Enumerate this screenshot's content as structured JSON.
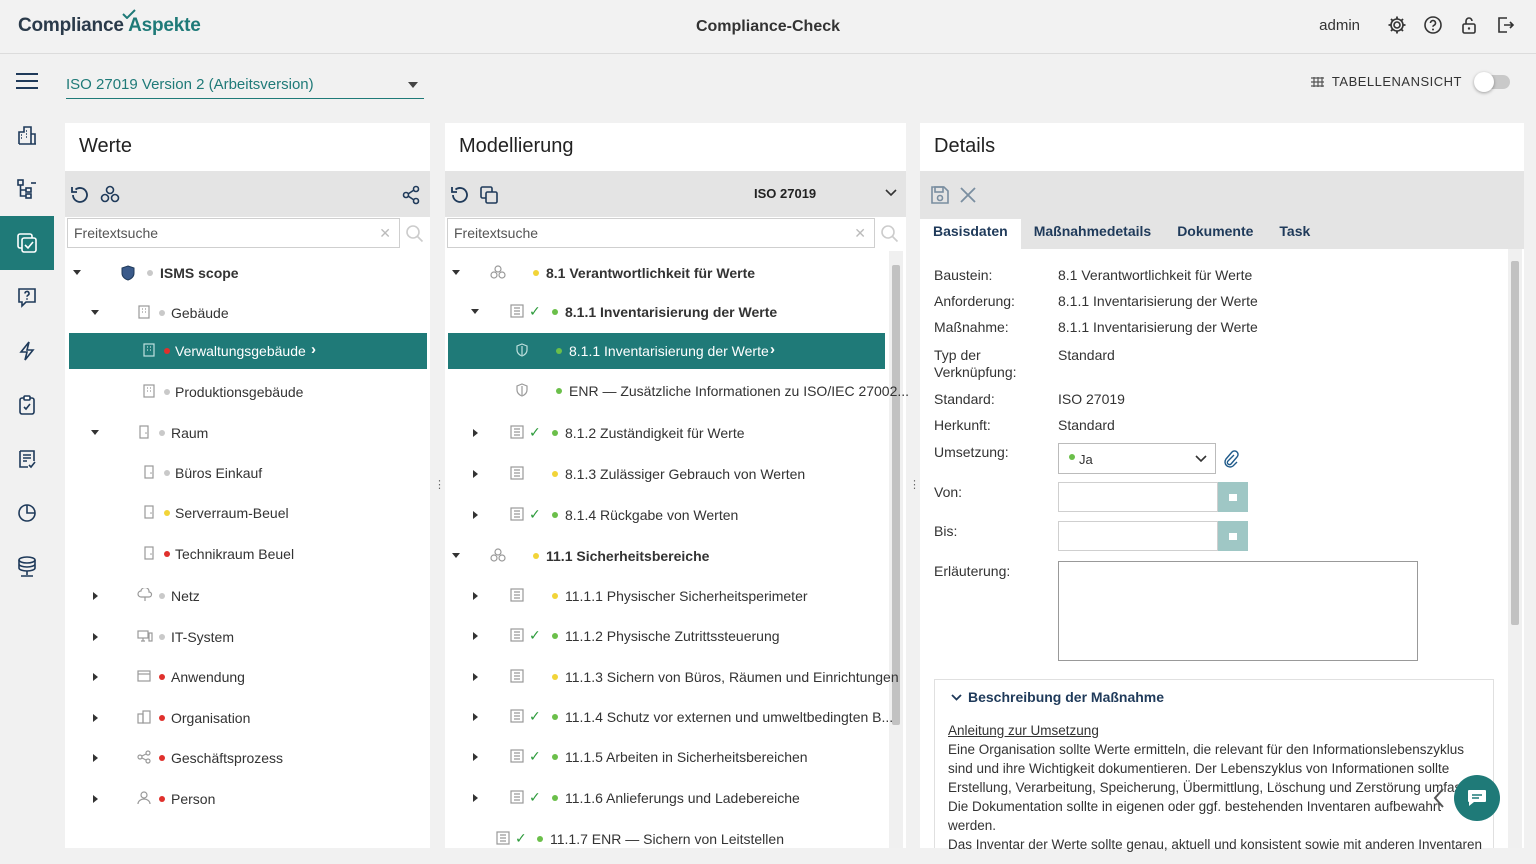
{
  "header": {
    "logo_part1": "Compliance",
    "logo_part2": "Aspekte",
    "title": "Compliance-Check",
    "user": "admin",
    "icons": [
      "gear-icon",
      "help-icon",
      "lock-icon",
      "logout-icon"
    ]
  },
  "nav": {
    "items": [
      "menu-icon",
      "buildings-icon",
      "tree-icon",
      "compliance-icon",
      "question-icon",
      "lightning-icon",
      "clipboard-check-icon",
      "report-icon",
      "pie-chart-icon",
      "database-icon"
    ],
    "active_color": "#1f7a78"
  },
  "toolbar": {
    "standard_select": "ISO 27019 Version 2 (Arbeitsversion)",
    "table_view_label": "TABELLENANSICHT"
  },
  "werte": {
    "title": "Werte",
    "search_placeholder": "Freitextsuche",
    "items": [
      {
        "label": "ISMS scope",
        "dot": "grey",
        "bold": true
      },
      {
        "label": "Gebäude",
        "dot": "grey"
      },
      {
        "label": "Verwaltungsgebäude",
        "dot": "red",
        "selected": true
      },
      {
        "label": "Produktionsgebäude",
        "dot": "grey"
      },
      {
        "label": "Raum",
        "dot": "grey"
      },
      {
        "label": "Büros Einkauf",
        "dot": "grey"
      },
      {
        "label": "Serverraum-Beuel",
        "dot": "yellow"
      },
      {
        "label": "Technikraum Beuel",
        "dot": "red"
      },
      {
        "label": "Netz",
        "dot": "grey"
      },
      {
        "label": "IT-System",
        "dot": "grey"
      },
      {
        "label": "Anwendung",
        "dot": "red"
      },
      {
        "label": "Organisation",
        "dot": "red"
      },
      {
        "label": "Geschäftsprozess",
        "dot": "red"
      },
      {
        "label": "Person",
        "dot": "red"
      }
    ]
  },
  "modellierung": {
    "title": "Modellierung",
    "standard": "ISO 27019",
    "search_placeholder": "Freitextsuche",
    "items": [
      {
        "label": "8.1 Verantwortlichkeit für Werte",
        "dot": "yellow",
        "bold": true
      },
      {
        "label": "8.1.1 Inventarisierung der Werte",
        "dot": "green",
        "bold": true,
        "checked": true
      },
      {
        "label": "8.1.1 Inventarisierung der Werte",
        "dot": "green",
        "selected": true
      },
      {
        "label": "ENR — Zusätzliche Informationen zu ISO/IEC 27002...",
        "dot": "green"
      },
      {
        "label": "8.1.2 Zuständigkeit für Werte",
        "dot": "green",
        "checked": true
      },
      {
        "label": "8.1.3 Zulässiger Gebrauch von Werten",
        "dot": "yellow"
      },
      {
        "label": "8.1.4 Rückgabe von Werten",
        "dot": "green",
        "checked": true
      },
      {
        "label": "11.1 Sicherheitsbereiche",
        "dot": "yellow",
        "bold": true
      },
      {
        "label": "11.1.1 Physischer Sicherheitsperimeter",
        "dot": "yellow"
      },
      {
        "label": "11.1.2 Physische Zutrittssteuerung",
        "dot": "green",
        "checked": true
      },
      {
        "label": "11.1.3 Sichern von Büros, Räumen und Einrichtungen",
        "dot": "yellow"
      },
      {
        "label": "11.1.4 Schutz vor externen und umweltbedingten B...",
        "dot": "green",
        "checked": true
      },
      {
        "label": "11.1.5 Arbeiten in Sicherheitsbereichen",
        "dot": "green",
        "checked": true
      },
      {
        "label": "11.1.6 Anlieferungs und Ladebereiche",
        "dot": "green",
        "checked": true
      },
      {
        "label": "11.1.7 ENR — Sichern von Leitstellen",
        "dot": "green",
        "checked": true
      }
    ]
  },
  "details": {
    "title": "Details",
    "tabs": [
      "Basisdaten",
      "Maßnahmedetails",
      "Dokumente",
      "Task"
    ],
    "fields": {
      "baustein_label": "Baustein:",
      "baustein": "8.1 Verantwortlichkeit für Werte",
      "anforderung_label": "Anforderung:",
      "anforderung": "8.1.1 Inventarisierung der Werte",
      "massnahme_label": "Maßnahme:",
      "massnahme": "8.1.1 Inventarisierung der Werte",
      "typ_label_1": "Typ der",
      "typ_label_2": "Verknüpfung:",
      "typ": "Standard",
      "standard_label": "Standard:",
      "standard": "ISO 27019",
      "herkunft_label": "Herkunft:",
      "herkunft": "Standard",
      "umsetzung_label": "Umsetzung:",
      "umsetzung": "Ja",
      "von_label": "Von:",
      "bis_label": "Bis:",
      "erlaeuterung_label": "Erläuterung:"
    },
    "description": {
      "title": "Beschreibung der Maßnahme",
      "link": "Anleitung zur Umsetzung",
      "lines": [
        "Eine Organisation sollte Werte ermitteln, die relevant für den Informationslebenszyklus",
        "sind und ihre Wichtigkeit dokumentieren. Der Lebenszyklus von Informationen sollte",
        "Erstellung, Verarbeitung, Speicherung, Übermittlung, Löschung und Zerstörung umfass",
        "Die Dokumentation sollte in eigenen oder ggf. bestehenden Inventaren aufbewahrt",
        "werden.",
        "Das Inventar der Werte sollte genau, aktuell und konsistent sowie mit anderen Inventaren"
      ]
    }
  }
}
